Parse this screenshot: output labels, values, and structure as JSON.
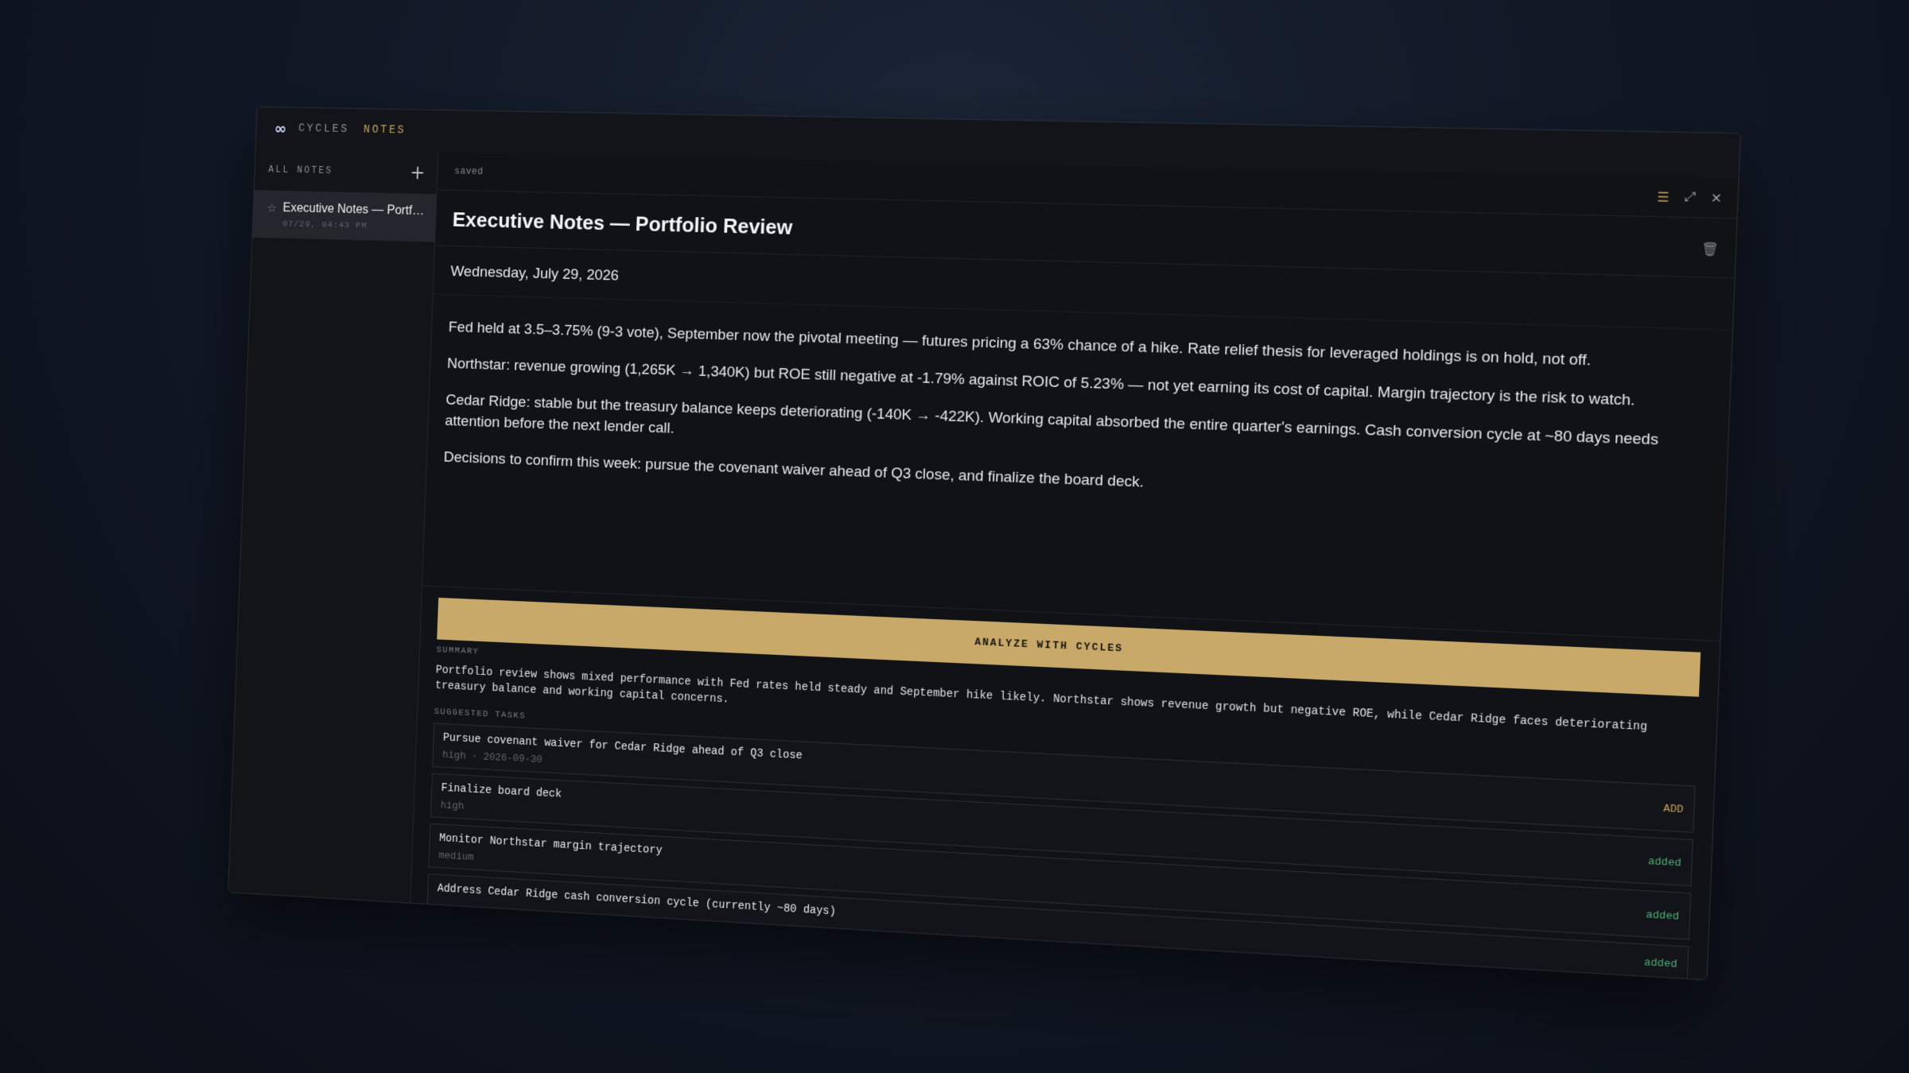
{
  "app": {
    "brand_primary": "CYCLES",
    "brand_secondary": "NOTES",
    "accent_color": "#c9a35a"
  },
  "sidebar": {
    "title": "ALL NOTES",
    "notes": [
      {
        "title": "Executive Notes — Portfolio Review",
        "date": "07/29, 04:43 PM"
      }
    ]
  },
  "toolbar": {
    "status": "saved",
    "icons": [
      "list-icon",
      "expand-icon",
      "close-icon"
    ]
  },
  "note": {
    "title": "Executive Notes — Portfolio Review",
    "date_line": "Wednesday, July 29, 2026",
    "paragraphs": [
      "Fed held at 3.5–3.75% (9-3 vote), September now the pivotal meeting — futures pricing a 63% chance of a hike. Rate relief thesis for leveraged holdings is on hold, not off.",
      "Northstar: revenue growing (1,265K → 1,340K) but ROE still negative at -1.79% against ROIC of 5.23% — not yet earning its cost of capital. Margin trajectory is the risk to watch.",
      "Cedar Ridge: stable but the treasury balance keeps deteriorating (-140K → -422K). Working capital absorbed the entire quarter's earnings. Cash conversion cycle at ~80 days needs attention before the next lender call.",
      "Decisions to confirm this week: pursue the covenant waiver ahead of Q3 close, and finalize the board deck."
    ]
  },
  "analysis": {
    "button_label": "ANALYZE WITH CYCLES",
    "summary_label": "SUMMARY",
    "summary": "Portfolio review shows mixed performance with Fed rates held steady and September hike likely. Northstar shows revenue growth but negative ROE, while Cedar Ridge faces deteriorating treasury balance and working capital concerns.",
    "tasks_label": "SUGGESTED TASKS",
    "tasks": [
      {
        "name": "Pursue covenant waiver for Cedar Ridge ahead of Q3 close",
        "meta": "high · 2026-09-30",
        "action": "ADD",
        "state": "add"
      },
      {
        "name": "Finalize board deck",
        "meta": "high",
        "action": "added",
        "state": "added"
      },
      {
        "name": "Monitor Northstar margin trajectory",
        "meta": "medium",
        "action": "added",
        "state": "added"
      },
      {
        "name": "Address Cedar Ridge cash conversion cycle (currently ~80 days)",
        "meta": "",
        "action": "added",
        "state": "added"
      }
    ]
  }
}
